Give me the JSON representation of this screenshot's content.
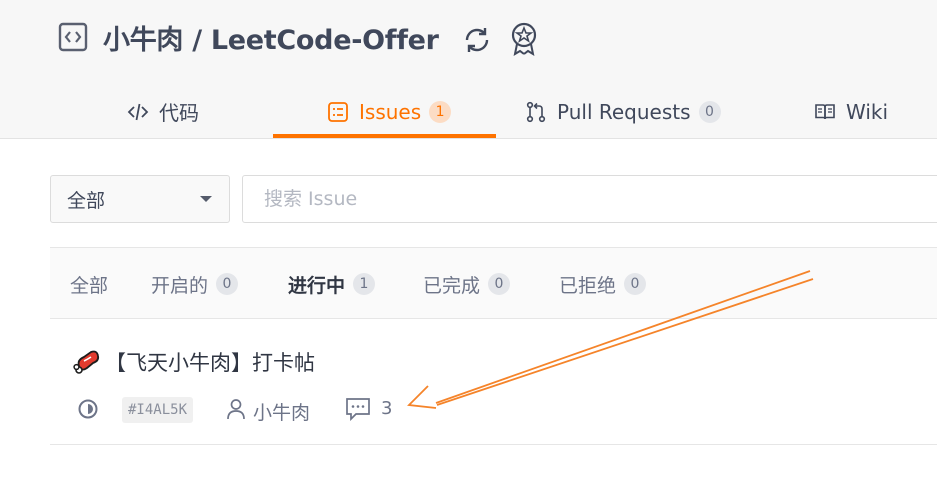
{
  "header": {
    "repo_owner": "小牛肉",
    "separator": " / ",
    "repo_name": "LeetCode-Offer",
    "icons": [
      "code-repo-icon",
      "sync-icon",
      "award-icon"
    ]
  },
  "tabs": [
    {
      "label": "代码",
      "icon": "code-icon",
      "count": null,
      "active": false
    },
    {
      "label": "Issues",
      "icon": "issues-icon",
      "count": "1",
      "active": true
    },
    {
      "label": "Pull Requests",
      "icon": "pull-request-icon",
      "count": "0",
      "active": false
    },
    {
      "label": "Wiki",
      "icon": "wiki-icon",
      "count": null,
      "active": false
    }
  ],
  "filter": {
    "select_value": "全部",
    "search_placeholder": "搜索 Issue"
  },
  "state_tabs": [
    {
      "label": "全部",
      "count": null,
      "active": false
    },
    {
      "label": "开启的",
      "count": "0",
      "active": false
    },
    {
      "label": "进行中",
      "count": "1",
      "active": true
    },
    {
      "label": "已完成",
      "count": "0",
      "active": false
    },
    {
      "label": "已拒绝",
      "count": "0",
      "active": false
    }
  ],
  "issue": {
    "title": "【飞天小牛肉】打卡帖",
    "id": "#I4AL5K",
    "author": "小牛肉",
    "comments": "3",
    "state_icon": "in-progress-icon"
  },
  "colors": {
    "accent": "#fe7300",
    "text": "#40485b",
    "muted": "#6d7488",
    "badge_orange_bg": "#fcdcc4",
    "badge_gray_bg": "#e4e6ea",
    "header_bg": "#f7f7f7"
  }
}
